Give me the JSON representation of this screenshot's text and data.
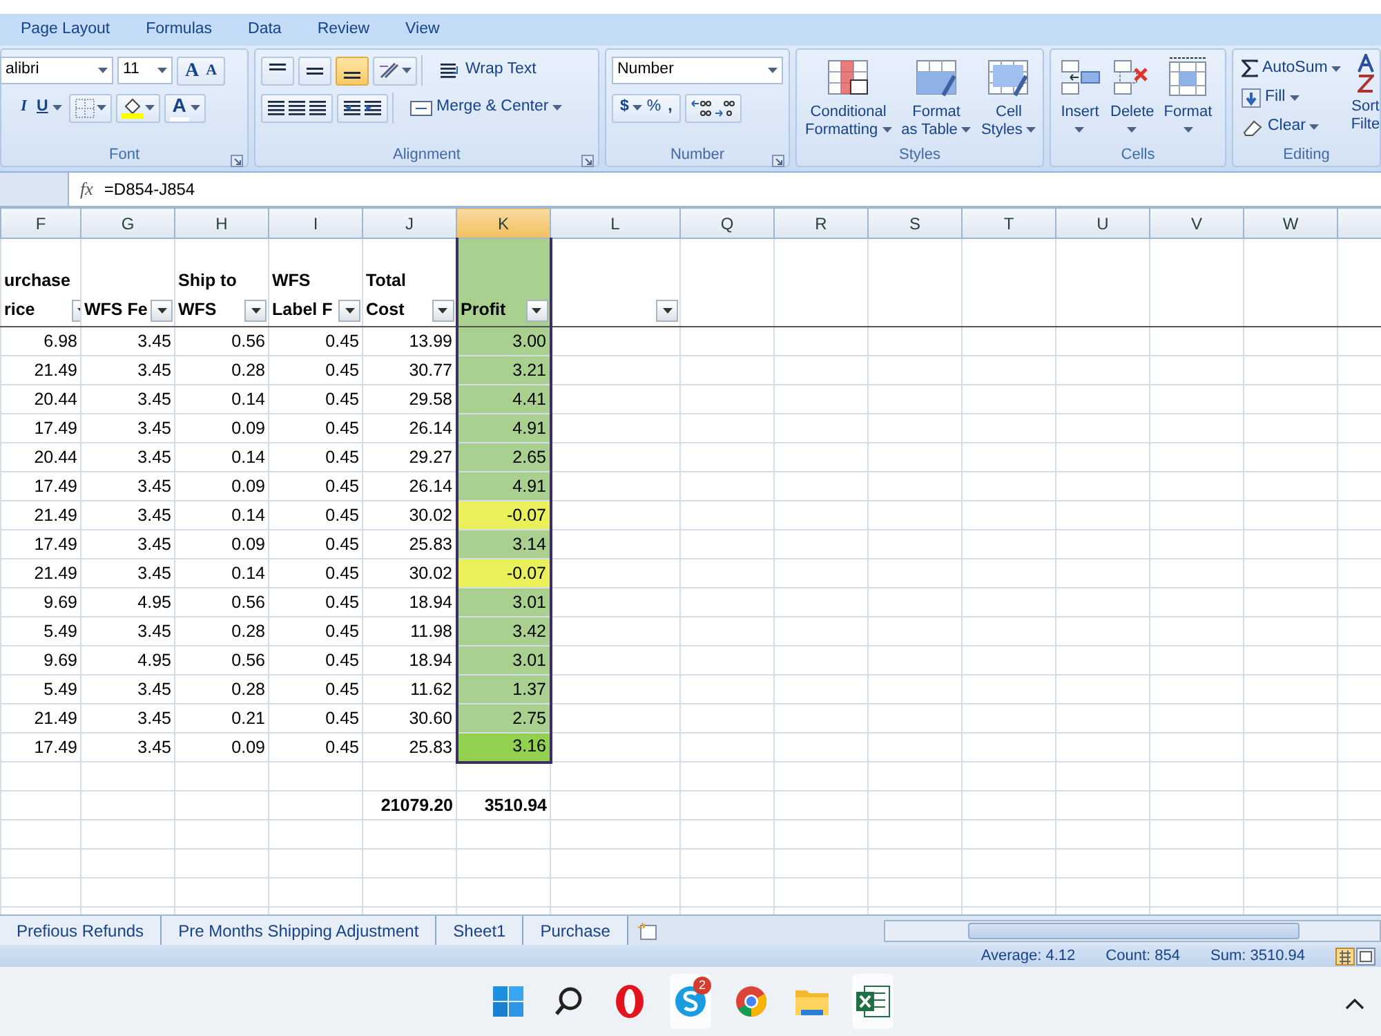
{
  "ribbon_tabs": [
    {
      "label": "Page Layout",
      "selected": false
    },
    {
      "label": "Formulas",
      "selected": false
    },
    {
      "label": "Data",
      "selected": false
    },
    {
      "label": "Review",
      "selected": false
    },
    {
      "label": "View",
      "selected": false
    }
  ],
  "ribbon": {
    "font": {
      "name": "alibri",
      "size": "11",
      "grow": "A",
      "shrink": "A",
      "italic": "I",
      "underline": "U",
      "font_color": "A",
      "label": "Font"
    },
    "alignment": {
      "vertical": [
        {
          "selected": false
        },
        {
          "selected": false
        },
        {
          "selected": true
        }
      ],
      "wrap_text": "Wrap Text",
      "merge_center": "Merge & Center",
      "label": "Alignment"
    },
    "number": {
      "format": "Number",
      "currency": "$",
      "percent": "%",
      "comma": ",",
      "label": "Number"
    },
    "styles": {
      "conditional_formatting": [
        "Conditional",
        "Formatting"
      ],
      "format_as_table": [
        "Format",
        "as Table"
      ],
      "cell_styles": [
        "Cell",
        "Styles"
      ],
      "label": "Styles"
    },
    "cells": {
      "insert": "Insert",
      "delete": "Delete",
      "format": "Format",
      "label": "Cells"
    },
    "editing": {
      "autosum": "AutoSum",
      "fill": "Fill",
      "clear": "Clear",
      "sort_filter": [
        "Sort",
        "Filte"
      ],
      "label": "Editing"
    }
  },
  "formula_bar": {
    "function_label": "fx",
    "formula": "=D854-J854"
  },
  "columns": [
    {
      "letter": "F",
      "selected": false
    },
    {
      "letter": "G",
      "selected": false
    },
    {
      "letter": "H",
      "selected": false
    },
    {
      "letter": "I",
      "selected": false
    },
    {
      "letter": "J",
      "selected": false
    },
    {
      "letter": "K",
      "selected": true
    },
    {
      "letter": "L",
      "selected": false
    },
    {
      "letter": "Q",
      "selected": false
    },
    {
      "letter": "R",
      "selected": false
    },
    {
      "letter": "S",
      "selected": false
    },
    {
      "letter": "T",
      "selected": false
    },
    {
      "letter": "U",
      "selected": false
    },
    {
      "letter": "V",
      "selected": false
    },
    {
      "letter": "W",
      "selected": false
    }
  ],
  "header_row": [
    [
      "urchase",
      "rice"
    ],
    [
      "WFS Fe"
    ],
    [
      "Ship to",
      "WFS"
    ],
    [
      "WFS",
      "Label F"
    ],
    [
      "Total",
      "Cost"
    ],
    [
      "Profit"
    ]
  ],
  "empty_column_filter": true,
  "rows": [
    {
      "cells": [
        "6.98",
        "3.45",
        "0.56",
        "0.45",
        "13.99"
      ],
      "profit": "3.00",
      "color": "#a9d08e"
    },
    {
      "cells": [
        "21.49",
        "3.45",
        "0.28",
        "0.45",
        "30.77"
      ],
      "profit": "3.21",
      "color": "#a9d08e"
    },
    {
      "cells": [
        "20.44",
        "3.45",
        "0.14",
        "0.45",
        "29.58"
      ],
      "profit": "4.41",
      "color": "#a9d08e"
    },
    {
      "cells": [
        "17.49",
        "3.45",
        "0.09",
        "0.45",
        "26.14"
      ],
      "profit": "4.91",
      "color": "#a9d08e"
    },
    {
      "cells": [
        "20.44",
        "3.45",
        "0.14",
        "0.45",
        "29.27"
      ],
      "profit": "2.65",
      "color": "#a9d08e"
    },
    {
      "cells": [
        "17.49",
        "3.45",
        "0.09",
        "0.45",
        "26.14"
      ],
      "profit": "4.91",
      "color": "#a9d08e"
    },
    {
      "cells": [
        "21.49",
        "3.45",
        "0.14",
        "0.45",
        "30.02"
      ],
      "profit": "-0.07",
      "color": "#eaf05a"
    },
    {
      "cells": [
        "17.49",
        "3.45",
        "0.09",
        "0.45",
        "25.83"
      ],
      "profit": "3.14",
      "color": "#a9d08e"
    },
    {
      "cells": [
        "21.49",
        "3.45",
        "0.14",
        "0.45",
        "30.02"
      ],
      "profit": "-0.07",
      "color": "#eaf05a"
    },
    {
      "cells": [
        "9.69",
        "4.95",
        "0.56",
        "0.45",
        "18.94"
      ],
      "profit": "3.01",
      "color": "#a9d08e"
    },
    {
      "cells": [
        "5.49",
        "3.45",
        "0.28",
        "0.45",
        "11.98"
      ],
      "profit": "3.42",
      "color": "#a9d08e"
    },
    {
      "cells": [
        "9.69",
        "4.95",
        "0.56",
        "0.45",
        "18.94"
      ],
      "profit": "3.01",
      "color": "#a9d08e"
    },
    {
      "cells": [
        "5.49",
        "3.45",
        "0.28",
        "0.45",
        "11.62"
      ],
      "profit": "1.37",
      "color": "#a9d08e"
    },
    {
      "cells": [
        "21.49",
        "3.45",
        "0.21",
        "0.45",
        "30.60"
      ],
      "profit": "2.75",
      "color": "#a9d08e"
    },
    {
      "cells": [
        "17.49",
        "3.45",
        "0.09",
        "0.45",
        "25.83"
      ],
      "profit": "3.16",
      "color": "#92d050"
    }
  ],
  "totals": {
    "total_cost": "21079.20",
    "profit": "3510.94"
  },
  "sheet_tabs": [
    {
      "label": "Prefious Refunds",
      "selected": false
    },
    {
      "label": "Pre Months Shipping Adjustment",
      "selected": false
    },
    {
      "label": "Sheet1",
      "selected": false
    },
    {
      "label": "Purchase",
      "selected": false
    }
  ],
  "status_bar": {
    "average": "Average: 4.12",
    "count": "Count: 854",
    "sum": "Sum: 3510.94"
  },
  "taskbar": {
    "skype_badge": "2"
  }
}
